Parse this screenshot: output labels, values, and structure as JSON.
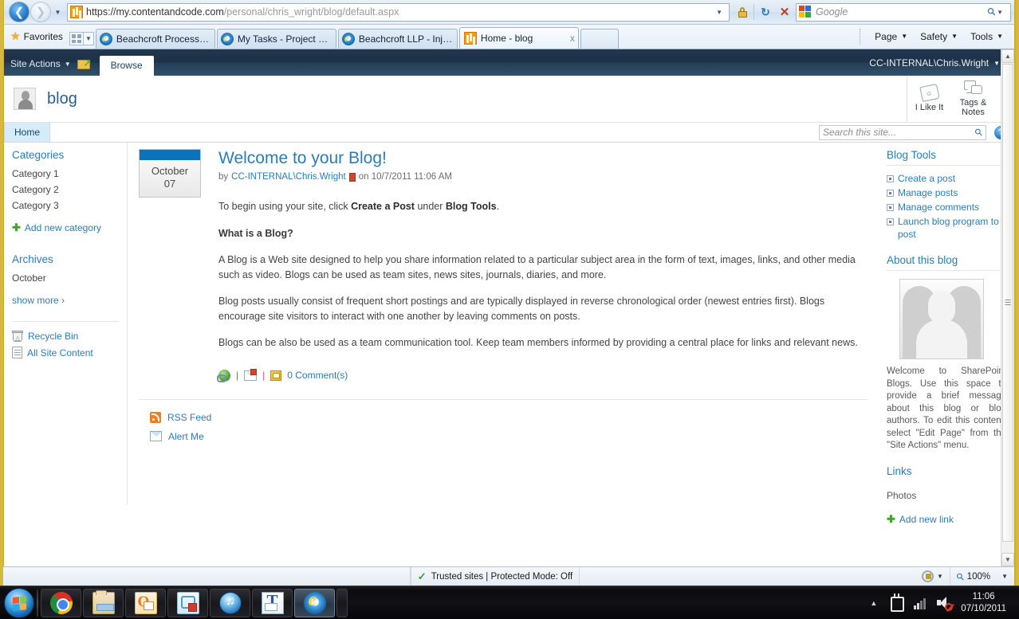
{
  "browser": {
    "url_main": "https://my.contentandcode.com",
    "url_path": "/personal/chris_wright/blog/default.aspx",
    "search_placeholder": "Google",
    "favorites_label": "Favorites",
    "nav_back_icon": "back-arrow-icon",
    "nav_forward_icon": "forward-arrow-icon",
    "tabs": [
      {
        "title": "Beachcroft Process Diagra...",
        "icon": "ie-favicon",
        "active": false
      },
      {
        "title": "My Tasks - Project Web Ac...",
        "icon": "ie-favicon",
        "active": false
      },
      {
        "title": "Beachcroft LLP - Injury Ris...",
        "icon": "ie-favicon",
        "active": false
      },
      {
        "title": "Home - blog",
        "icon": "sharepoint-favicon",
        "active": true
      }
    ],
    "tab_close_label": "x",
    "command_bar": [
      {
        "label": "Page"
      },
      {
        "label": "Safety"
      },
      {
        "label": "Tools"
      }
    ],
    "statusbar": {
      "zone_text": "Trusted sites | Protected Mode: Off",
      "zoom": "100%"
    }
  },
  "sharepoint": {
    "ribbon": {
      "site_actions": "Site Actions",
      "browse_tab": "Browse",
      "user": "CC-INTERNAL\\Chris.Wright"
    },
    "site_title": "blog",
    "social": [
      {
        "label": "I Like It",
        "icon": "tag-like-icon"
      },
      {
        "label": "Tags &\nNotes",
        "label_line1": "Tags &",
        "label_line2": "Notes",
        "icon": "tags-notes-icon"
      }
    ],
    "nav": {
      "home": "Home"
    },
    "search": {
      "placeholder": "Search this site...",
      "icon": "search-icon"
    },
    "help_icon": "help-icon"
  },
  "left_sidebar": {
    "categories_heading": "Categories",
    "categories": [
      "Category 1",
      "Category 2",
      "Category 3"
    ],
    "add_category": "Add new category",
    "archives_heading": "Archives",
    "archives": [
      "October"
    ],
    "show_more": "show more ›",
    "recycle_bin": "Recycle Bin",
    "all_site_content": "All Site Content"
  },
  "post": {
    "date_month": "October",
    "date_day": "07",
    "title": "Welcome to your Blog!",
    "by_label": "by",
    "author": "CC-INTERNAL\\Chris.Wright",
    "on_label": "on 10/7/2011 11:06 AM",
    "paragraph_1_pre": "To begin using your site, click ",
    "paragraph_1_b1": "Create a Post",
    "paragraph_1_mid": " under ",
    "paragraph_1_b2": "Blog Tools",
    "paragraph_1_post": ".",
    "heading_2": "What is a Blog?",
    "paragraph_2": "A Blog is a Web site designed to help you share information related to a particular subject area in the form of text, images, links, and other media such as video. Blogs can be used as team sites, news sites, journals, diaries, and more.",
    "paragraph_3": "Blog posts usually consist of frequent short postings and are typically displayed in reverse chronological order (newest entries first). Blogs encourage site visitors to interact with one another by leaving comments on posts.",
    "paragraph_4": "Blogs can be also be used as a team communication tool. Keep team members informed by providing a central place for links and relevant news.",
    "comments_link": "0 Comment(s)",
    "sep": "|",
    "permalink_icon": "globe-link-icon",
    "email_icon": "email-post-icon",
    "comment_icon": "comment-note-icon"
  },
  "feeds": {
    "rss": "RSS Feed",
    "alert": "Alert Me"
  },
  "right_sidebar": {
    "blog_tools_heading": "Blog Tools",
    "blog_tools": [
      "Create a post",
      "Manage posts",
      "Manage comments",
      "Launch blog program to post"
    ],
    "about_heading": "About this blog",
    "about_text": "Welcome to SharePoint Blogs. Use this space to provide a brief message about this blog or blog authors. To edit this content, select \"Edit Page\" from the \"Site Actions\" menu.",
    "about_image_icon": "people-silhouette-image",
    "links_heading": "Links",
    "links": [
      "Photos"
    ],
    "add_link": "Add new link"
  },
  "taskbar": {
    "start_label": "start-orb",
    "buttons": [
      {
        "name": "chrome",
        "icon": "chrome-icon"
      },
      {
        "name": "windows-explorer",
        "icon": "folder-icon"
      },
      {
        "name": "outlook",
        "icon": "outlook-icon"
      },
      {
        "name": "lync",
        "icon": "lync-icon"
      },
      {
        "name": "itunes",
        "icon": "itunes-icon"
      },
      {
        "name": "text-editor",
        "icon": "text-editor-icon"
      },
      {
        "name": "internet-explorer",
        "icon": "ie-icon"
      }
    ],
    "tray": {
      "time": "11:06",
      "date": "07/10/2011"
    }
  },
  "colors": {
    "accent_blue": "#2b7cb8",
    "ribbon_dark": "#1d3147",
    "date_bar": "#0d73b8",
    "chrome_gold": "#d4b93c",
    "green_plus": "#3fa62b"
  }
}
